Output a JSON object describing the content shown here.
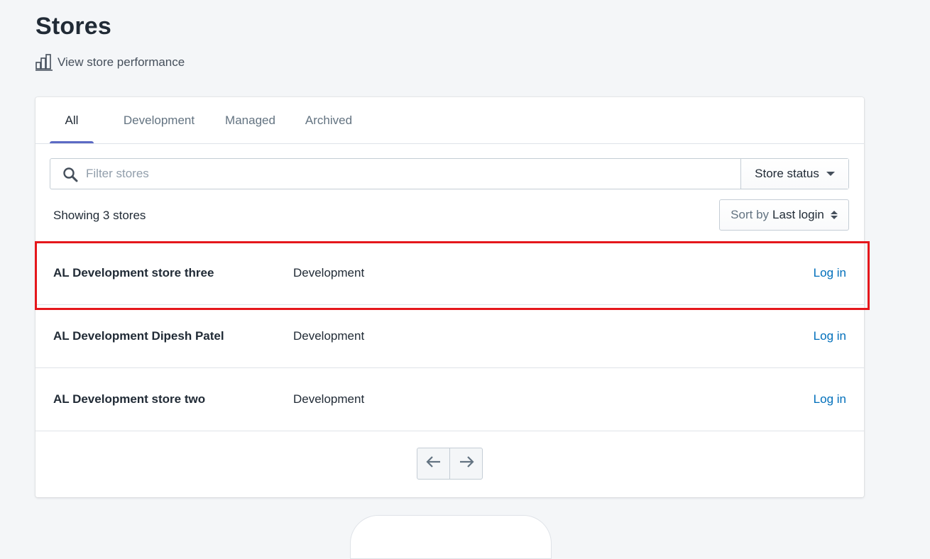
{
  "page": {
    "title": "Stores",
    "performance_link": "View store performance"
  },
  "tabs": [
    {
      "label": "All",
      "active": true
    },
    {
      "label": "Development",
      "active": false
    },
    {
      "label": "Managed",
      "active": false
    },
    {
      "label": "Archived",
      "active": false
    }
  ],
  "filter": {
    "placeholder": "Filter stores",
    "value": "",
    "status_button": "Store status"
  },
  "list": {
    "count_text": "Showing 3 stores",
    "sort_prefix": "Sort by",
    "sort_value": "Last login",
    "stores": [
      {
        "name": "AL Development store three",
        "type": "Development",
        "action": "Log in",
        "highlighted": true
      },
      {
        "name": "AL Development Dipesh Patel",
        "type": "Development",
        "action": "Log in",
        "highlighted": false
      },
      {
        "name": "AL Development store two",
        "type": "Development",
        "action": "Log in",
        "highlighted": false
      }
    ]
  },
  "pagination": {
    "prev_icon": "arrow-left-icon",
    "next_icon": "arrow-right-icon"
  },
  "colors": {
    "accent": "#5c6ac4",
    "link": "#006fbb",
    "highlight": "#e5171c",
    "background": "#f4f6f8"
  }
}
